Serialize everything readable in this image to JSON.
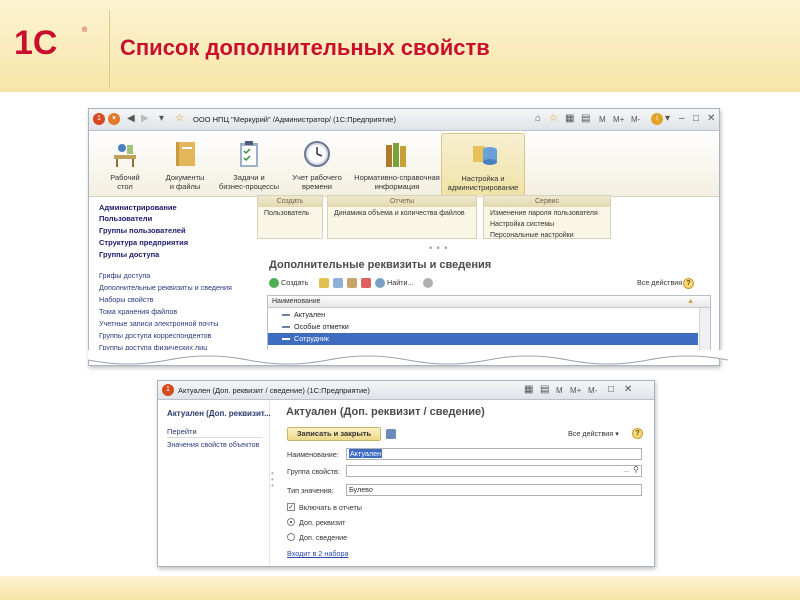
{
  "slide": {
    "title": "Список дополнительных свойств",
    "logo_text": "1С"
  },
  "window1": {
    "title": "ООО НПЦ \"Меркурий\" /Администратор/  (1С:Предприятие)",
    "sections": [
      {
        "label": "Рабочий\nстол",
        "icon": "desk-icon"
      },
      {
        "label": "Документы\nи файлы",
        "icon": "folder-icon"
      },
      {
        "label": "Задачи и\nбизнес-процессы",
        "icon": "clipboard-icon"
      },
      {
        "label": "Учет рабочего\nвремени",
        "icon": "clock-icon"
      },
      {
        "label": "Нормативно-справочная\nинформация",
        "icon": "books-icon"
      },
      {
        "label": "Настройка и\nадминистрирование",
        "icon": "admin-icon"
      }
    ],
    "nav_bold": [
      "Администрирование",
      "Пользователи",
      "Группы пользователей",
      "Структура предприятия",
      "Группы доступа"
    ],
    "nav_items": [
      "Грифы доступа",
      "Дополнительные реквизиты и сведения",
      "Наборы свойств",
      "Тома хранения файлов",
      "Учетные записи электронной почты",
      "Группы доступа корреспондентов",
      "Группы доступа физических лиц"
    ],
    "groups": [
      {
        "header": "Создать",
        "items": [
          "Пользователь"
        ]
      },
      {
        "header": "Отчеты",
        "items": [
          "Динамика объема и количества файлов"
        ]
      },
      {
        "header": "Сервис",
        "items": [
          "Изменение пароля пользователя",
          "Настройка системы",
          "Персональные настройки"
        ]
      }
    ],
    "form_title": "Дополнительные реквизиты и сведения",
    "toolbar": {
      "create": "Создать",
      "find": "Найти...",
      "all_actions": "Все действия ▾"
    },
    "grid": {
      "header": "Наименование",
      "rows": [
        "Актуален",
        "Особые отметки",
        "Сотрудник"
      ],
      "selected_index": 2
    }
  },
  "window2": {
    "title": "Актуален (Доп. реквизит / сведение)  (1С:Предприятие)",
    "left_title": "Актуален (Доп. реквизит...",
    "goto_label": "Перейти",
    "goto_link": "Значения свойств объектов",
    "main_title": "Актуален (Доп. реквизит / сведение)",
    "save_close": "Записать и закрыть",
    "all_actions": "Все действия ▾",
    "fields": {
      "name_label": "Наименование:",
      "name_value": "Актуален",
      "group_label": "Группа свойств:",
      "group_value": "",
      "type_label": "Тип значения:",
      "type_value": "Булево"
    },
    "include_in_reports": "Включать в отчеты",
    "include_checked": true,
    "options": [
      "Доп. реквизит",
      "Доп. сведение"
    ],
    "selected_option": 0,
    "sets_link": "Входит в 2 набора"
  },
  "colors": {
    "brand_red": "#c8102e",
    "selection": "#3d6cc0",
    "header_bg": "#f7e6a8"
  }
}
